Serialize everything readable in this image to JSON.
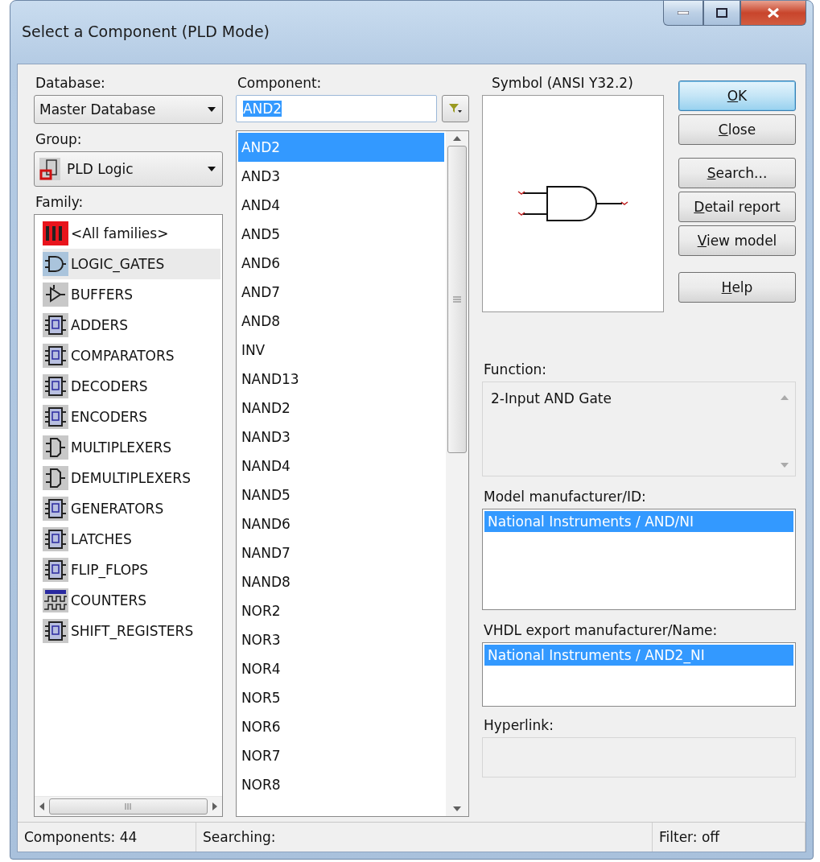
{
  "window": {
    "title": "Select a Component (PLD Mode)"
  },
  "database": {
    "label": "Database:",
    "value": "Master Database"
  },
  "group": {
    "label": "Group:",
    "value": "PLD Logic"
  },
  "family": {
    "label": "Family:",
    "items": [
      {
        "label": "<All families>",
        "kind": "all",
        "selected": false
      },
      {
        "label": "LOGIC_GATES",
        "kind": "gate",
        "selected": true
      },
      {
        "label": "BUFFERS",
        "kind": "buffer",
        "selected": false
      },
      {
        "label": "ADDERS",
        "kind": "chip",
        "selected": false
      },
      {
        "label": "COMPARATORS",
        "kind": "chip",
        "selected": false
      },
      {
        "label": "DECODERS",
        "kind": "chip",
        "selected": false
      },
      {
        "label": "ENCODERS",
        "kind": "chip",
        "selected": false
      },
      {
        "label": "MULTIPLEXERS",
        "kind": "mux",
        "selected": false
      },
      {
        "label": "DEMULTIPLEXERS",
        "kind": "mux",
        "selected": false
      },
      {
        "label": "GENERATORS",
        "kind": "chip",
        "selected": false
      },
      {
        "label": "LATCHES",
        "kind": "chip",
        "selected": false
      },
      {
        "label": "FLIP_FLOPS",
        "kind": "chip",
        "selected": false
      },
      {
        "label": "COUNTERS",
        "kind": "counter",
        "selected": false
      },
      {
        "label": "SHIFT_REGISTERS",
        "kind": "chip",
        "selected": false
      }
    ]
  },
  "component": {
    "label": "Component:",
    "value": "AND2",
    "items": [
      {
        "label": "AND2",
        "selected": true
      },
      {
        "label": "AND3",
        "selected": false
      },
      {
        "label": "AND4",
        "selected": false
      },
      {
        "label": "AND5",
        "selected": false
      },
      {
        "label": "AND6",
        "selected": false
      },
      {
        "label": "AND7",
        "selected": false
      },
      {
        "label": "AND8",
        "selected": false
      },
      {
        "label": "INV",
        "selected": false
      },
      {
        "label": "NAND13",
        "selected": false
      },
      {
        "label": "NAND2",
        "selected": false
      },
      {
        "label": "NAND3",
        "selected": false
      },
      {
        "label": "NAND4",
        "selected": false
      },
      {
        "label": "NAND5",
        "selected": false
      },
      {
        "label": "NAND6",
        "selected": false
      },
      {
        "label": "NAND7",
        "selected": false
      },
      {
        "label": "NAND8",
        "selected": false
      },
      {
        "label": "NOR2",
        "selected": false
      },
      {
        "label": "NOR3",
        "selected": false
      },
      {
        "label": "NOR4",
        "selected": false
      },
      {
        "label": "NOR5",
        "selected": false
      },
      {
        "label": "NOR6",
        "selected": false
      },
      {
        "label": "NOR7",
        "selected": false
      },
      {
        "label": "NOR8",
        "selected": false
      }
    ]
  },
  "symbol": {
    "label": "Symbol (ANSI Y32.2)"
  },
  "buttons": [
    {
      "label": "OK",
      "default": true
    },
    {
      "label": "Close",
      "default": false
    },
    {
      "label": "Search...",
      "default": false
    },
    {
      "label": "Detail report",
      "default": false
    },
    {
      "label": "View model",
      "default": false
    },
    {
      "label": "Help",
      "default": false
    }
  ],
  "function": {
    "label": "Function:",
    "value": "2-Input AND Gate"
  },
  "model": {
    "label": "Model manufacturer/ID:",
    "items": [
      {
        "label": "National Instruments / AND/NI",
        "selected": true
      }
    ]
  },
  "vhdl": {
    "label": "VHDL export manufacturer/Name:",
    "items": [
      {
        "label": "National Instruments / AND2_NI",
        "selected": true
      }
    ]
  },
  "hyperlink": {
    "label": "Hyperlink:"
  },
  "status_bar": [
    "Components: 44",
    "Searching:",
    "Filter: off"
  ]
}
